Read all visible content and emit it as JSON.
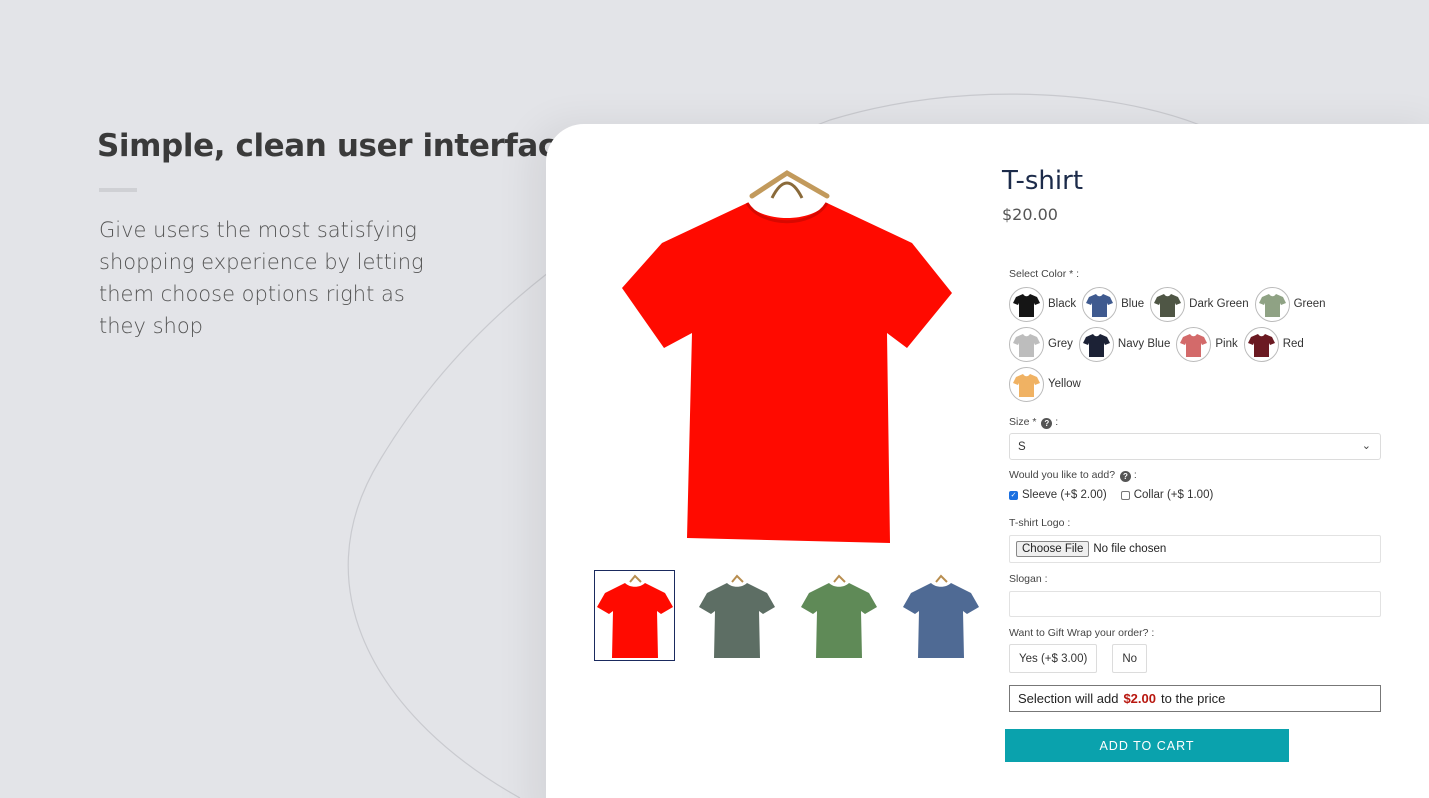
{
  "promo": {
    "heading": "Simple, clean user interface",
    "description": "Give users the most satisfying shopping experience by letting them choose options right as they shop"
  },
  "product": {
    "title": "T-shirt",
    "price": "$20.00",
    "main_image_color": "#ff0a00",
    "thumbnails": [
      {
        "color": "#ff0a00",
        "active": true
      },
      {
        "color": "#5d6e64",
        "active": false
      },
      {
        "color": "#5f8a57",
        "active": false
      },
      {
        "color": "#4f6a94",
        "active": false
      }
    ]
  },
  "options": {
    "color": {
      "label": "Select Color * :",
      "choices": [
        {
          "name": "Black",
          "hex": "#151515"
        },
        {
          "name": "Blue",
          "hex": "#3f5a8f"
        },
        {
          "name": "Dark Green",
          "hex": "#4f5645"
        },
        {
          "name": "Green",
          "hex": "#8fa284"
        },
        {
          "name": "Grey",
          "hex": "#bdbdbd"
        },
        {
          "name": "Navy Blue",
          "hex": "#1c2236"
        },
        {
          "name": "Pink",
          "hex": "#d36a6a"
        },
        {
          "name": "Red",
          "hex": "#6b1a22"
        },
        {
          "name": "Yellow",
          "hex": "#f0b263"
        }
      ]
    },
    "size": {
      "label": "Size *",
      "label_suffix": ":",
      "help_icon": "question-circle-icon",
      "value": "S"
    },
    "addons": {
      "label": "Would you like to add?",
      "label_suffix": ":",
      "items": [
        {
          "label": "Sleeve (+$ 2.00)",
          "checked": true
        },
        {
          "label": "Collar (+$ 1.00)",
          "checked": false
        }
      ]
    },
    "logo": {
      "label": "T-shirt Logo :",
      "button": "Choose File",
      "status": "No file chosen"
    },
    "slogan": {
      "label": "Slogan :",
      "value": ""
    },
    "gift_wrap": {
      "label": "Want to Gift Wrap your order? :",
      "options": [
        "Yes (+$ 3.00)",
        "No"
      ]
    }
  },
  "summary": {
    "prefix": "Selection will add",
    "amount": "$2.00",
    "suffix": "to the price"
  },
  "cart": {
    "button": "ADD TO CART"
  },
  "colors": {
    "accent": "#0aa2ad",
    "highlight_price": "#b8170f"
  }
}
